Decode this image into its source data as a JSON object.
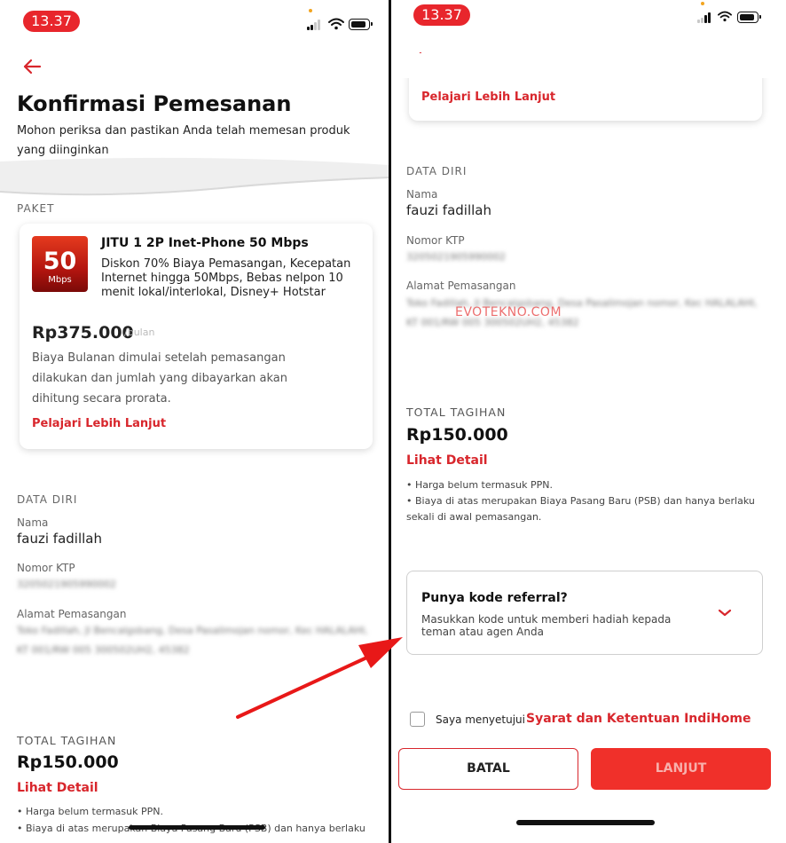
{
  "status_bar": {
    "time_left": "13.37",
    "time_right": "13.37"
  },
  "left": {
    "title": "Konfirmasi Pemesanan",
    "subtitle": "Mohon periksa dan pastikan Anda telah memesan produk yang diinginkan",
    "paket_label": "PAKET",
    "package": {
      "badge_number": "50",
      "badge_unit": "Mbps",
      "name": "JITU 1 2P Inet-Phone 50 Mbps",
      "description": "Diskon 70% Biaya Pemasangan, Kecepatan Internet hingga 50Mbps, Bebas nelpon 10 menit lokal/interlokal, Disney+ Hotstar",
      "price": "Rp375.000",
      "price_period": "/bulan",
      "note": "Biaya Bulanan dimulai setelah pemasangan dilakukan dan jumlah yang dibayarkan akan dihitung secara prorata.",
      "learn_more": "Pelajari Lebih Lanjut"
    },
    "data_diri": {
      "section": "DATA DIRI",
      "nama_label": "Nama",
      "nama_value": "fauzi fadillah",
      "ktp_label": "Nomor KTP",
      "ktp_value": "3205021905990002",
      "alamat_label": "Alamat Pemasangan",
      "alamat_value": "Toko Fadillah, Jl Bencalgsbang, Desa Pasalimojan nomor, Kec HALALAHI, KT 001/RW 005 300502UH2, 45382"
    },
    "total": {
      "label": "TOTAL TAGIHAN",
      "amount": "Rp150.000",
      "detail_link": "Lihat Detail",
      "note1": "• Harga belum termasuk PPN.",
      "note2": "• Biaya di atas merupakan Biaya Pasang Baru (PSB) dan hanya berlaku"
    }
  },
  "right": {
    "learn_more": "Pelajari Lebih Lanjut",
    "data_diri": {
      "section": "DATA DIRI",
      "nama_label": "Nama",
      "nama_value": "fauzi fadillah",
      "ktp_label": "Nomor KTP",
      "ktp_value": "3205021905990002",
      "alamat_label": "Alamat Pemasangan",
      "alamat_value": "Toko Fadillah, Jl Bencalgsbang, Desa Pasalimojan nomor, Kec HALALAHI, KT 001/RW 005 300502UH2, 45382"
    },
    "watermark": "EVOTEKNO.COM",
    "total": {
      "label": "TOTAL TAGIHAN",
      "amount": "Rp150.000",
      "detail_link": "Lihat Detail",
      "note1": "• Harga belum termasuk PPN.",
      "note2": "• Biaya di atas merupakan Biaya Pasang Baru (PSB) dan hanya berlaku sekali di awal pemasangan."
    },
    "referral": {
      "title": "Punya kode referral?",
      "description": "Masukkan kode untuk memberi hadiah kepada teman atau agen Anda"
    },
    "agreement": {
      "text": "Saya menyetujui",
      "link": "Syarat dan Ketentuan IndiHome"
    },
    "buttons": {
      "cancel": "BATAL",
      "next": "LANJUT"
    }
  },
  "colors": {
    "accent": "#d8262c",
    "arrow": "#e81818",
    "button": "#f0302a"
  },
  "icons": [
    "back-arrow-icon",
    "signal-icon",
    "wifi-icon",
    "battery-icon",
    "chevron-down-icon"
  ]
}
